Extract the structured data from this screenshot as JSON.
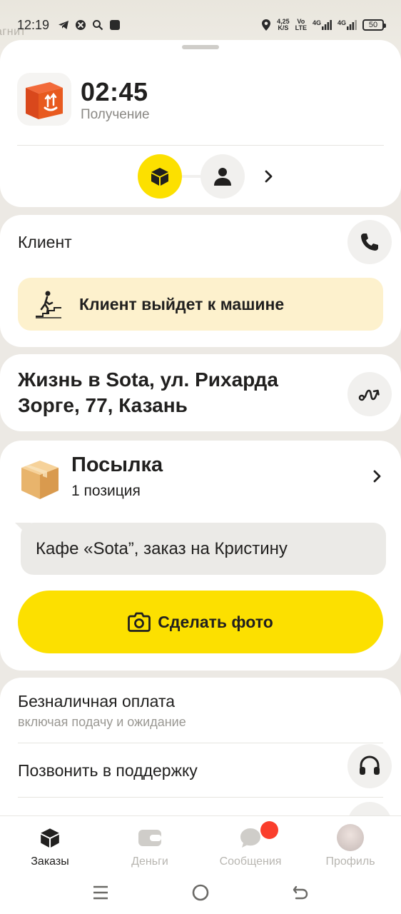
{
  "map": {
    "street_label": "агнит"
  },
  "status_bar": {
    "time": "12:19",
    "speed_value": "4,25",
    "speed_unit": "K/S",
    "volte_top": "Vo",
    "volte_bottom": "LTE",
    "net1": "4G",
    "net2": "4G",
    "battery": "50"
  },
  "order": {
    "timer": "02:45",
    "stage": "Получение"
  },
  "client": {
    "label": "Клиент",
    "note": "Клиент выйдет к машине"
  },
  "address": "Жизнь в Sota, ул. Рихарда Зорге, 77, Казань",
  "parcel": {
    "title": "Посылка",
    "count": "1 позиция",
    "comment": "Кафе «Sota”, заказ на Кристину",
    "photo_button": "Сделать фото"
  },
  "payment": {
    "title": "Безналичная оплата",
    "subtitle": "включая подачу и ожидание",
    "support": "Позвонить в поддержку"
  },
  "tabs": [
    {
      "label": "Заказы",
      "icon": "box-icon",
      "active": true
    },
    {
      "label": "Деньги",
      "icon": "wallet-icon",
      "active": false
    },
    {
      "label": "Сообщения",
      "icon": "chat-icon",
      "active": false
    },
    {
      "label": "Профиль",
      "icon": "avatar",
      "active": false
    }
  ],
  "colors": {
    "accent": "#fce000",
    "note_bg": "#fdf1cd",
    "badge": "#fa3e2c",
    "parcel_icon": "#e85a1f"
  }
}
